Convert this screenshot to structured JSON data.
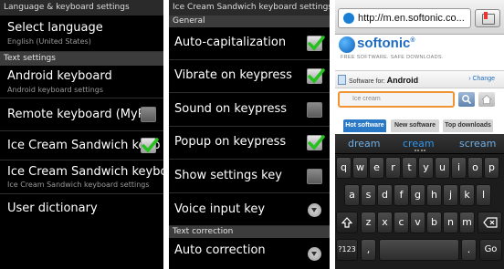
{
  "panel1": {
    "title": "Language & keyboard settings",
    "select_language": {
      "label": "Select language",
      "sub": "English (United States)"
    },
    "section": "Text settings",
    "android_keyboard": {
      "label": "Android keyboard",
      "sub": "Android keyboard settings"
    },
    "remote_keyboard": {
      "label": "Remote keyboard (MyPh",
      "checked": false
    },
    "ics_keyboard_toggle": {
      "label": "Ice Cream Sandwich keyb",
      "checked": true
    },
    "ics_keyboard": {
      "label": "Ice Cream Sandwich keyboard",
      "sub": "Ice Cream Sandwich keyboard settings"
    },
    "user_dictionary": {
      "label": "User dictionary"
    }
  },
  "panel2": {
    "title": "Ice Cream Sandwich keyboard settings",
    "section_general": "General",
    "items": [
      {
        "label": "Auto-capitalization",
        "checked": true
      },
      {
        "label": "Vibrate on keypress",
        "checked": true
      },
      {
        "label": "Sound on keypress",
        "checked": false
      },
      {
        "label": "Popup on keypress",
        "checked": true
      },
      {
        "label": "Show settings key",
        "checked": false
      },
      {
        "label": "Voice input key",
        "control": "dropdown"
      }
    ],
    "section_correction": "Text correction",
    "auto_correction": {
      "label": "Auto correction"
    }
  },
  "panel3": {
    "url": "http://m.en.softonic.co...",
    "brand": "softonic",
    "brand_mark": "®",
    "tagline": "FREE SOFTWARE. SAFE DOWNLOADS.",
    "software_for_label": "Software for:",
    "platform": "Android",
    "change_link": "› Change",
    "search_value": "Ice cream",
    "tabs": [
      "Hot software",
      "New software",
      "Top downloads"
    ],
    "suggestions": [
      "dream",
      "cream",
      "scream"
    ],
    "keyboard": {
      "row1": [
        "q",
        "w",
        "e",
        "r",
        "t",
        "y",
        "u",
        "i",
        "o",
        "p"
      ],
      "row2": [
        "a",
        "s",
        "d",
        "f",
        "g",
        "h",
        "j",
        "k",
        "l"
      ],
      "row3": [
        "z",
        "x",
        "c",
        "v",
        "b",
        "n",
        "m"
      ],
      "numbers_key": "?123",
      "comma_key": ",",
      "period_key": ".",
      "go_key": "Go"
    }
  },
  "colors": {
    "check_green": "#25c21e",
    "section_bg": "#3c3c3c",
    "softonic_blue": "#1e6cc0",
    "search_border": "#f09330",
    "suggestion_blue": "#2f96ef"
  }
}
